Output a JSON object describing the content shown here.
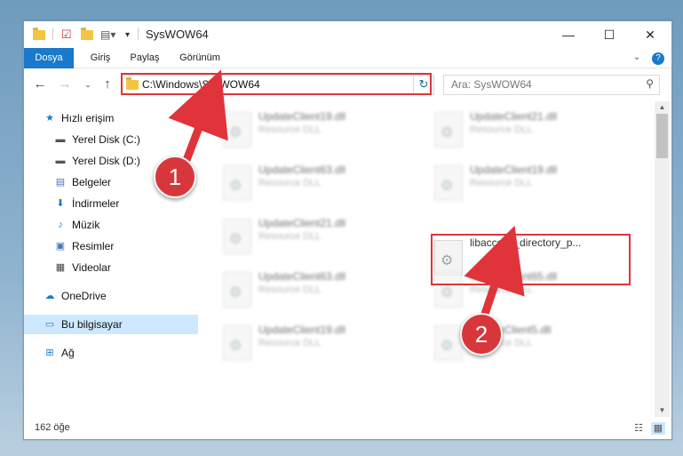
{
  "window": {
    "title": "SysWOW64"
  },
  "ribbon": {
    "tabs": [
      "Dosya",
      "Giriş",
      "Paylaş",
      "Görünüm"
    ]
  },
  "address": {
    "path": "C:\\Windows\\SysWOW64"
  },
  "search": {
    "placeholder": "Ara: SysWOW64"
  },
  "nav": {
    "quick_access": "Hızlı erişim",
    "items": [
      {
        "label": "Yerel Disk (C:)"
      },
      {
        "label": "Yerel Disk (D:)"
      },
      {
        "label": "Belgeler"
      },
      {
        "label": "İndirmeler"
      },
      {
        "label": "Müzik"
      },
      {
        "label": "Resimler"
      },
      {
        "label": "Videolar"
      }
    ],
    "onedrive": "OneDrive",
    "this_pc": "Bu bilgisayar",
    "network": "Ağ"
  },
  "files": {
    "left": [
      {
        "name": "UpdateClient19.dll",
        "desc": "Resource DLL"
      },
      {
        "name": "UpdateClient63.dll",
        "desc": "Resource DLL"
      },
      {
        "name": "UpdateClient21.dll",
        "desc": "Resource DLL"
      },
      {
        "name": "UpdateClient63.dll",
        "desc": "Resource DLL"
      },
      {
        "name": "UpdateClient19.dll",
        "desc": "Resource DLL"
      }
    ],
    "right": [
      {
        "name": "UpdateClient21.dll",
        "desc": "Resource DLL"
      },
      {
        "name": "UpdateClient19.dll",
        "desc": "Resource DLL"
      },
      {
        "name": "UpdateClient65.dll",
        "desc": "Resource DLL"
      },
      {
        "name": "UpdateClient5.dll",
        "desc": "Resource DLL"
      }
    ],
    "highlighted": "libaccess_directory_p..."
  },
  "status": {
    "count": "162 öğe"
  },
  "annotations": {
    "one": "1",
    "two": "2"
  },
  "colors": {
    "accent": "#1979ca",
    "highlight": "#e0343a"
  }
}
